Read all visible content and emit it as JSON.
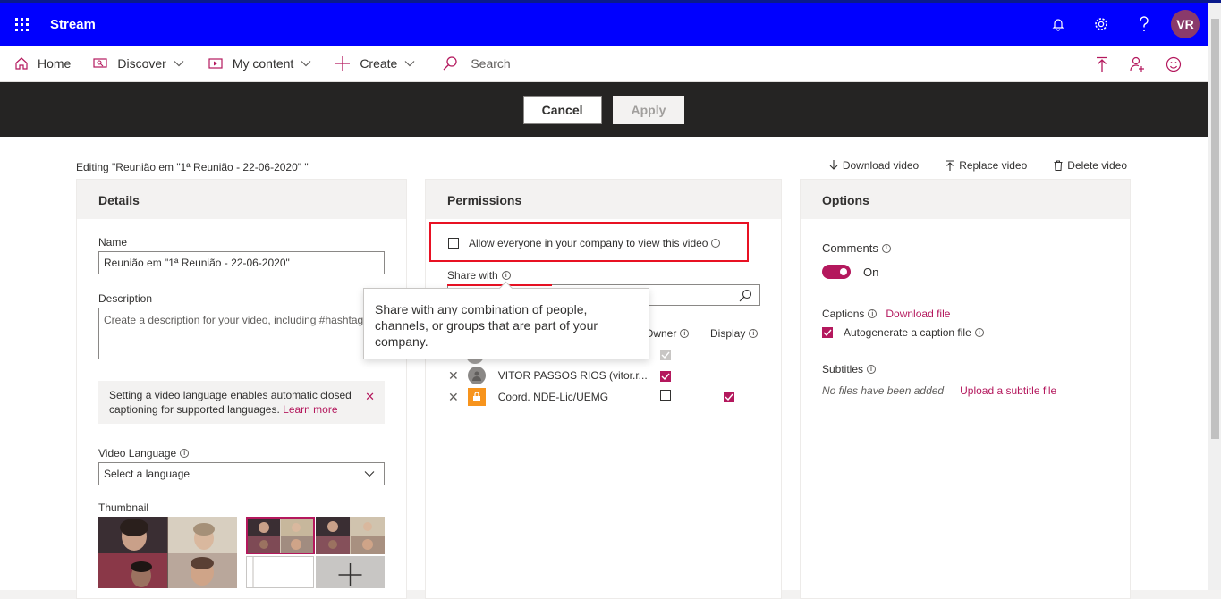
{
  "suitebar": {
    "brand": "Stream",
    "avatar_initials": "VR",
    "icons": [
      "waffle-icon",
      "bell-icon",
      "gear-icon",
      "help-icon"
    ]
  },
  "nav": {
    "home": "Home",
    "discover": "Discover",
    "my_content": "My content",
    "create": "Create",
    "search_placeholder": "Search"
  },
  "actions": {
    "cancel": "Cancel",
    "apply": "Apply"
  },
  "editing_label": "Editing \"Reunião em \"1ª Reunião - 22-06-2020\" \"",
  "file_actions": {
    "download": "Download video",
    "replace": "Replace video",
    "delete": "Delete video"
  },
  "details": {
    "title": "Details",
    "name_label": "Name",
    "name_value": "Reunião em \"1ª Reunião - 22-06-2020\"",
    "description_label": "Description",
    "description_placeholder": "Create a description for your video, including #hashtags",
    "notice_text": "Setting a video language enables automatic closed captioning for supported languages.",
    "notice_link": "Learn more",
    "language_label": "Video Language",
    "language_value": "Select a language",
    "thumbnail_label": "Thumbnail"
  },
  "permissions": {
    "title": "Permissions",
    "allow_everyone": "Allow everyone in your company to view this video",
    "share_with_label": "Share with",
    "owner_col": "Owner",
    "display_col": "Display",
    "rows": [
      {
        "name": "VITOR PASSOS RIOS (vitor.r...",
        "owner": true,
        "display": false
      },
      {
        "name": "Coord. NDE-Lic/UEMG",
        "owner": false,
        "display": true
      }
    ],
    "tooltip": "Share with any combination of people, channels, or groups that are part of your company."
  },
  "options": {
    "title": "Options",
    "comments_label": "Comments",
    "comments_state": "On",
    "captions_label": "Captions",
    "captions_link": "Download file",
    "autogenerate": "Autogenerate a caption file",
    "subtitles_label": "Subtitles",
    "no_files": "No files have been added",
    "upload_subtitle": "Upload a subtitle file"
  },
  "colors": {
    "suitebar": "#0000ff",
    "accent": "#b4185d",
    "actionbar": "#252423"
  }
}
